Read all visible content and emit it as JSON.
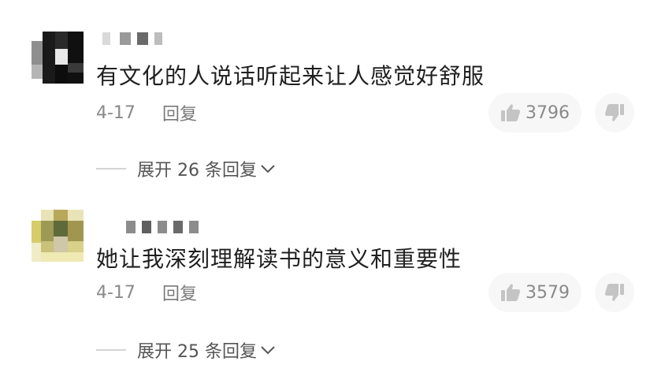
{
  "comments": [
    {
      "text": "有文化的人说话听起来让人感觉好舒服",
      "date": "4-17",
      "reply_label": "回复",
      "likes": "3796",
      "expand_label": "展开 26 条回复"
    },
    {
      "text": "她让我深刻理解读书的意义和重要性",
      "date": "4-17",
      "reply_label": "回复",
      "likes": "3579",
      "expand_label": "展开 25 条回复"
    }
  ],
  "colors": {
    "text": "#1f1f1f",
    "meta": "#8a8a8a",
    "pill": "#f7f7f7"
  }
}
